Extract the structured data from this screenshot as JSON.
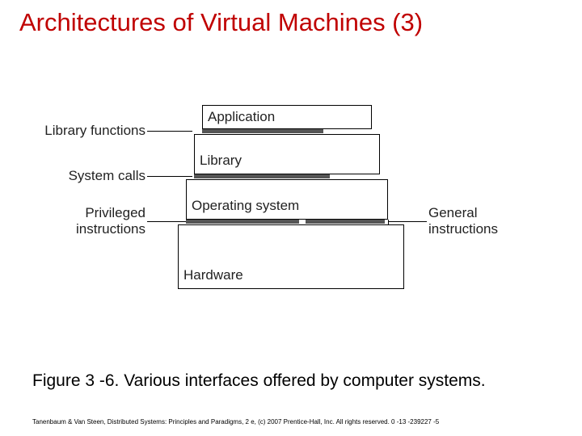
{
  "title": "Architectures of Virtual Machines (3)",
  "caption": "Figure 3 -6. Various interfaces offered by computer systems.",
  "copyright": "Tanenbaum & Van Steen, Distributed Systems: Principles and Paradigms, 2 e, (c) 2007 Prentice-Hall, Inc. All rights reserved. 0 -13 -239227 -5",
  "labels": {
    "left": {
      "library_functions": "Library functions",
      "system_calls": "System calls",
      "privileged_instructions": "Privileged\ninstructions"
    },
    "right": {
      "general_instructions": "General\ninstructions"
    }
  },
  "boxes": {
    "application": "Application",
    "library": "Library",
    "operating_system": "Operating system",
    "hardware": "Hardware"
  }
}
